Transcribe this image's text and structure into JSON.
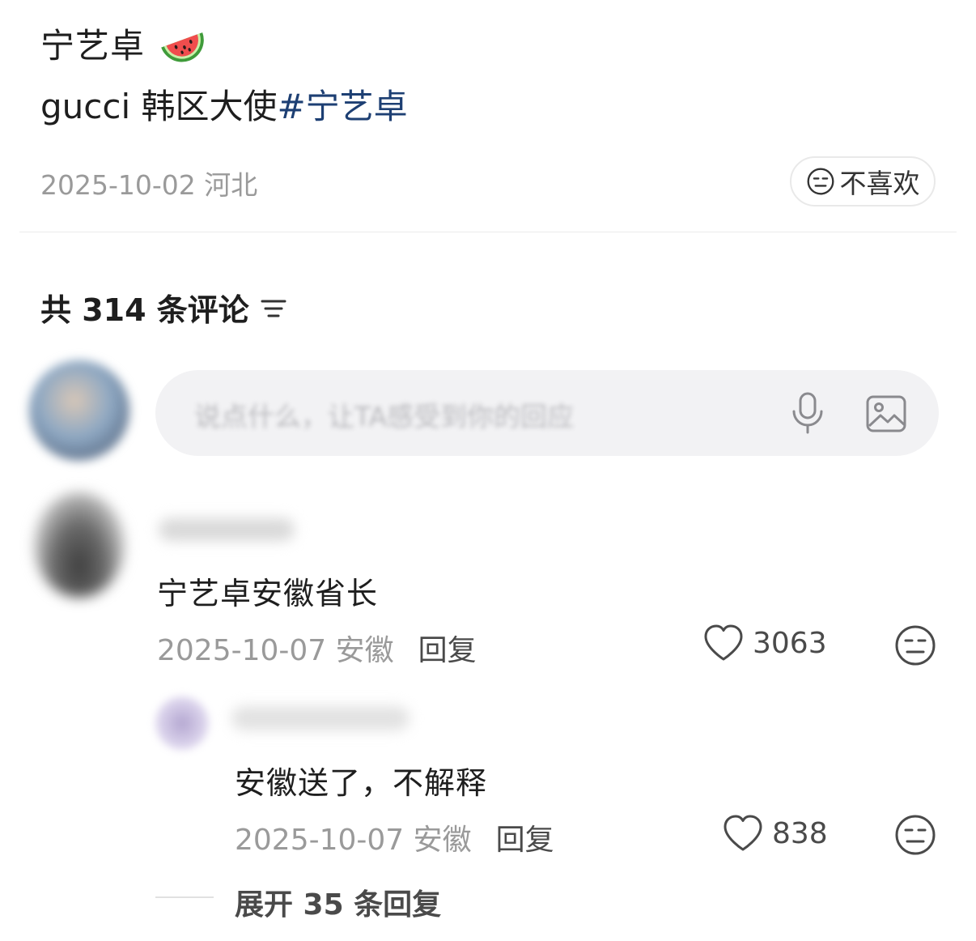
{
  "post": {
    "author": "宁艺卓",
    "author_emoji": "watermelon-icon",
    "text_prefix": "gucci 韩区大使",
    "hashtag": "#宁艺卓",
    "date_location": "2025-10-02 河北",
    "dislike_label": "不喜欢"
  },
  "comments_header": {
    "label": "共 314 条评论",
    "filter_icon": "filter-icon"
  },
  "composer": {
    "placeholder": "说点什么，让TA感受到你的回应",
    "icons": [
      "mic-icon",
      "image-icon"
    ]
  },
  "comment": {
    "text": "宁艺卓安徽省长",
    "date_location": "2025-10-07 安徽",
    "reply_label": "回复",
    "likes": "3063"
  },
  "reply": {
    "text": "安徽送了，不解释",
    "date_location": "2025-10-07 安徽",
    "reply_label": "回复",
    "likes": "838"
  },
  "expand": {
    "label": "展开 35 条回复"
  },
  "colors": {
    "hashtag": "#1d3f73",
    "meta": "#9a9a9a",
    "input_bg": "#f2f2f4"
  }
}
